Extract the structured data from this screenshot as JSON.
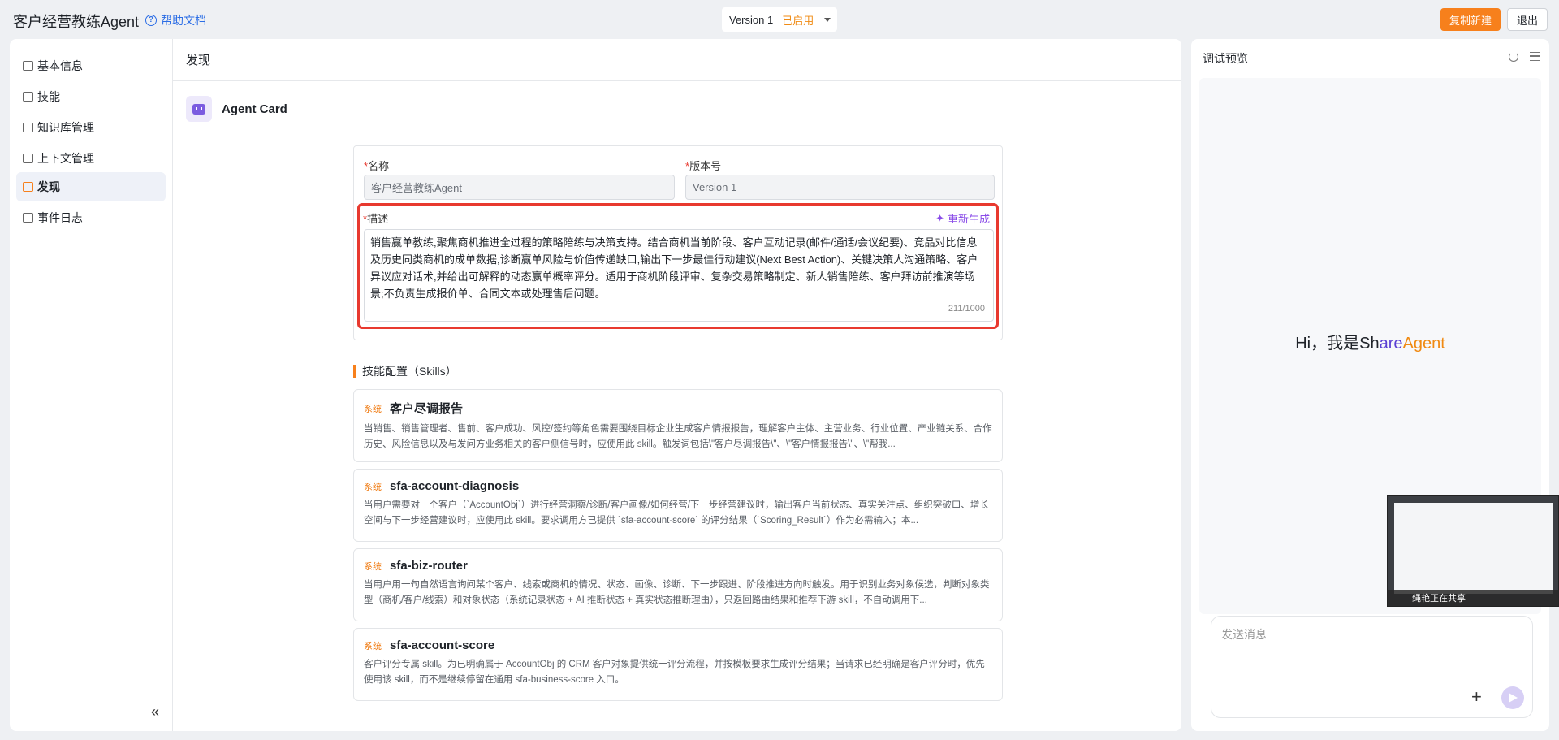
{
  "header": {
    "app_title": "客户经营教练Agent",
    "help_label": "帮助文档",
    "version_label": "Version 1",
    "version_status": "已启用",
    "copy_button": "复制新建",
    "exit_button": "退出"
  },
  "sidebar": {
    "items": [
      {
        "label": "基本信息",
        "icon": "info-card-icon"
      },
      {
        "label": "技能",
        "icon": "list-icon"
      },
      {
        "label": "知识库管理",
        "icon": "book-icon"
      },
      {
        "label": "上下文管理",
        "icon": "context-icon"
      },
      {
        "label": "发现",
        "icon": "discover-icon",
        "active": true
      },
      {
        "label": "事件日志",
        "icon": "log-icon"
      }
    ],
    "collapse_glyph": "«"
  },
  "main": {
    "title": "发现",
    "card_title": "Agent Card",
    "form": {
      "name_label": "名称",
      "name_value": "客户经营教练Agent",
      "version_label": "版本号",
      "version_value": "Version 1",
      "desc_label": "描述",
      "regen_label": "重新生成",
      "desc_value": "销售赢单教练,聚焦商机推进全过程的策略陪练与决策支持。结合商机当前阶段、客户互动记录(邮件/通话/会议纪要)、竞品对比信息及历史同类商机的成单数据,诊断赢单风险与价值传递缺口,输出下一步最佳行动建议(Next Best Action)、关键决策人沟通策略、客户异议应对话术,并给出可解释的动态赢单概率评分。适用于商机阶段评审、复杂交易策略制定、新人销售陪练、客户拜访前推演等场景;不负责生成报价单、合同文本或处理售后问题。",
      "desc_counter": "211/1000"
    },
    "skills_title": "技能配置（Skills）",
    "skills": [
      {
        "tag": "系统",
        "name": "客户尽调报告",
        "desc": "当销售、销售管理者、售前、客户成功、风控/签约等角色需要围绕目标企业生成客户情报报告，理解客户主体、主营业务、行业位置、产业链关系、合作历史、风险信息以及与发问方业务相关的客户侧信号时，应使用此 skill。触发词包括\\\"客户尽调报告\\\"、\\\"客户情报报告\\\"、\\\"帮我..."
      },
      {
        "tag": "系统",
        "name": "sfa-account-diagnosis",
        "desc": "当用户需要对一个客户（`AccountObj`）进行经营洞察/诊断/客户画像/如何经营/下一步经营建议时，输出客户当前状态、真实关注点、组织突破口、增长空间与下一步经营建议时，应使用此 skill。要求调用方已提供 `sfa-account-score` 的评分结果（`Scoring_Result`）作为必需输入；本..."
      },
      {
        "tag": "系统",
        "name": "sfa-biz-router",
        "desc": "当用户用一句自然语言询问某个客户、线索或商机的情况、状态、画像、诊断、下一步跟进、阶段推进方向时触发。用于识别业务对象候选，判断对象类型（商机/客户/线索）和对象状态（系统记录状态 + AI 推断状态 + 真实状态推断理由），只返回路由结果和推荐下游 skill，不自动调用下..."
      },
      {
        "tag": "系统",
        "name": "sfa-account-score",
        "desc": "客户评分专属 skill。为已明确属于 AccountObj 的 CRM 客户对象提供统一评分流程，并按模板要求生成评分结果；当请求已经明确是客户评分时，优先使用该 skill，而不是继续停留在通用 sfa-business-score 入口。"
      }
    ]
  },
  "preview": {
    "title": "调试预览",
    "greeting_prefix": "Hi，我是Sh",
    "greeting_mid": "are",
    "greeting_suffix": "Agent",
    "sharing_label": "绳艳正在共享",
    "input_placeholder": "发送消息",
    "plus_glyph": "+"
  },
  "colors": {
    "accent_orange": "#f7801c",
    "accent_purple": "#8a4ce8",
    "highlight_red": "#e8392f",
    "link_blue": "#2b6de5"
  }
}
